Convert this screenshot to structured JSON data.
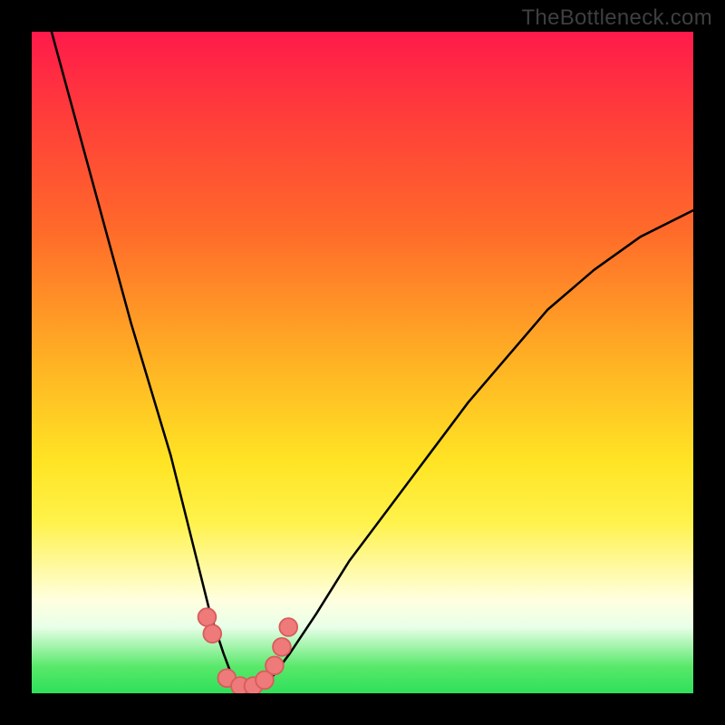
{
  "watermark": "TheBottleneck.com",
  "chart_data": {
    "type": "line",
    "title": "",
    "xlabel": "",
    "ylabel": "",
    "xlim": [
      0,
      100
    ],
    "ylim": [
      0,
      100
    ],
    "series": [
      {
        "name": "black-curve",
        "x": [
          3,
          6,
          9,
          12,
          15,
          18,
          21,
          23,
          25,
          27,
          29,
          30.5,
          32,
          34,
          36,
          39,
          43,
          48,
          54,
          60,
          66,
          72,
          78,
          85,
          92,
          100
        ],
        "values": [
          100,
          89,
          78,
          67,
          56,
          46,
          36,
          28,
          20,
          12,
          6,
          2,
          0,
          0,
          2,
          6,
          12,
          20,
          28,
          36,
          44,
          51,
          58,
          64,
          69,
          73
        ]
      },
      {
        "name": "marker-dots",
        "x": [
          26.5,
          27.3,
          29.5,
          31.5,
          33.5,
          35.2,
          36.7,
          37.8,
          38.8
        ],
        "values": [
          11.5,
          9.0,
          2.3,
          1.1,
          1.1,
          2.0,
          4.2,
          7.0,
          10.0
        ]
      }
    ],
    "gradient_bands": [
      {
        "stop": 0.0,
        "color": "red-pink"
      },
      {
        "stop": 0.5,
        "color": "orange"
      },
      {
        "stop": 0.75,
        "color": "yellow"
      },
      {
        "stop": 0.9,
        "color": "pale"
      },
      {
        "stop": 1.0,
        "color": "green"
      }
    ]
  },
  "colors": {
    "curve": "#000000",
    "marker_fill": "#ee7a7a",
    "marker_stroke": "#d85c5c"
  }
}
